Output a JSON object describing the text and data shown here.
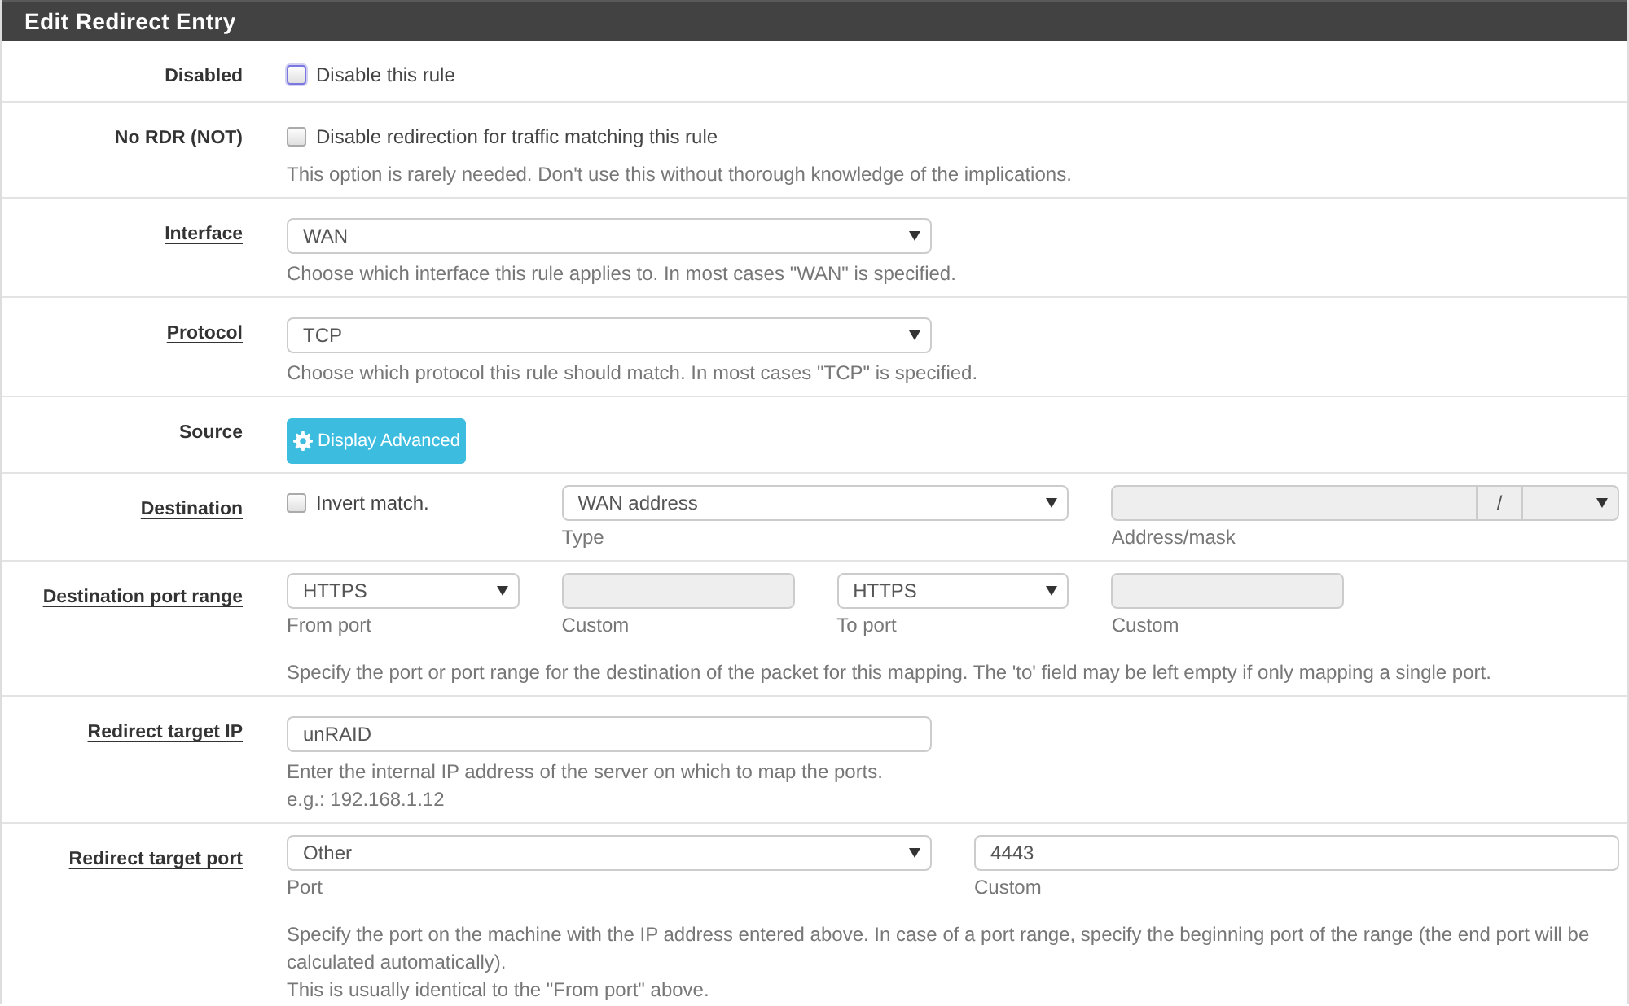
{
  "panel": {
    "title": "Edit Redirect Entry"
  },
  "rows": [
    {
      "kind": "single",
      "label": "Disabled",
      "link": false,
      "fields": [
        {
          "kind": "checkbox",
          "label": "Disable this rule",
          "checked": false,
          "focused": true
        }
      ]
    },
    {
      "kind": "single",
      "label": "No RDR (NOT)",
      "link": false,
      "fields": [
        {
          "kind": "checkbox",
          "label": "Disable redirection for traffic matching this rule",
          "checked": false,
          "focused": false
        }
      ],
      "help": [
        "This option is rarely needed. Don't use this without thorough knowledge of the implications."
      ]
    },
    {
      "kind": "single",
      "label": "Interface",
      "link": true,
      "fields": [
        {
          "kind": "select",
          "value": "WAN"
        }
      ],
      "help": [
        "Choose which interface this rule applies to. In most cases \"WAN\" is specified."
      ]
    },
    {
      "kind": "single",
      "label": "Protocol",
      "link": true,
      "fields": [
        {
          "kind": "select",
          "value": "TCP"
        }
      ],
      "help": [
        "Choose which protocol this rule should match. In most cases \"TCP\" is specified."
      ]
    },
    {
      "kind": "single",
      "label": "Source",
      "link": false,
      "fields": [
        {
          "kind": "button",
          "label": "Display Advanced"
        }
      ]
    },
    {
      "kind": "triple",
      "label": "Destination",
      "link": true,
      "fields": [
        {
          "kind": "checkbox",
          "label": "Invert match.",
          "checked": false,
          "focused": false
        },
        {
          "kind": "select",
          "value": "WAN address",
          "caption": "Type"
        },
        {
          "kind": "address",
          "separator": "/",
          "disabled": true,
          "caption": "Address/mask"
        }
      ]
    },
    {
      "kind": "quad",
      "label": "Destination port range",
      "link": true,
      "fields": [
        {
          "kind": "select",
          "value": "HTTPS",
          "caption": "From port"
        },
        {
          "kind": "text",
          "disabled": true,
          "caption": "Custom"
        },
        {
          "kind": "select",
          "value": "HTTPS",
          "caption": "To port"
        },
        {
          "kind": "text",
          "disabled": true,
          "caption": "Custom"
        }
      ],
      "help": [
        "Specify the port or port range for the destination of the packet for this mapping. The 'to' field may be left empty if only mapping a single port."
      ]
    },
    {
      "kind": "single",
      "label": "Redirect target IP",
      "link": true,
      "fields": [
        {
          "kind": "text",
          "value": "unRAID",
          "disabled": false
        }
      ],
      "help": [
        "Enter the internal IP address of the server on which to map the ports.",
        "e.g.: 192.168.1.12"
      ]
    },
    {
      "kind": "pair",
      "label": "Redirect target port",
      "link": true,
      "fields": [
        {
          "kind": "select",
          "value": "Other",
          "caption": "Port"
        },
        {
          "kind": "text",
          "value": "4443",
          "disabled": false,
          "caption": "Custom"
        }
      ],
      "help": [
        "Specify the port on the machine with the IP address entered above. In case of a port range, specify the beginning port of the range (the end port will be calculated automatically).",
        "This is usually identical to the \"From port\" above."
      ]
    }
  ]
}
